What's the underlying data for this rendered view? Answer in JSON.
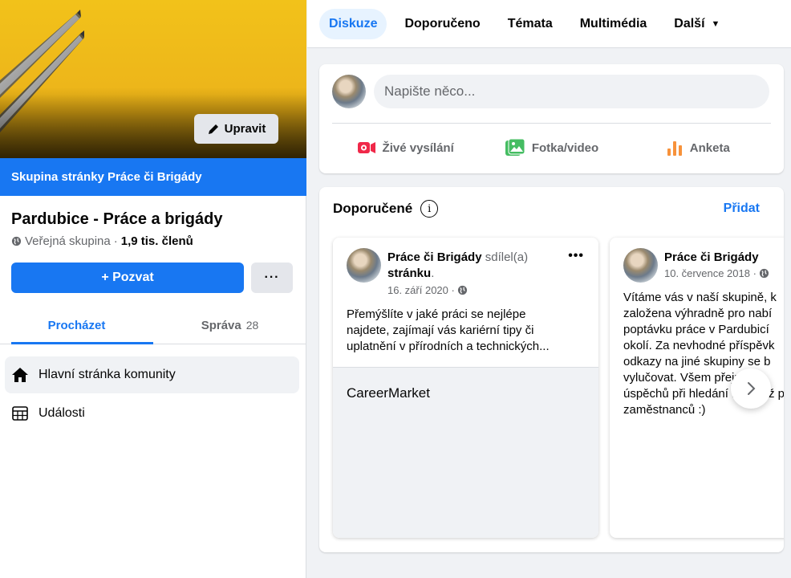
{
  "cover": {
    "edit_label": "Upravit"
  },
  "group": {
    "banner": "Skupina stránky Práce či Brigády",
    "name": "Pardubice - Práce a brigády",
    "privacy": "Veřejná skupina",
    "separator": "·",
    "members": "1,9 tis. členů",
    "invite_label": "+ Pozvat",
    "more_label": "···"
  },
  "left_tabs": [
    {
      "label": "Procházet"
    },
    {
      "label": "Správa",
      "count": "28"
    }
  ],
  "left_nav": [
    {
      "label": "Hlavní stránka komunity",
      "icon": "home-icon"
    },
    {
      "label": "Události",
      "icon": "calendar-icon"
    }
  ],
  "top_nav": [
    {
      "label": "Diskuze"
    },
    {
      "label": "Doporučeno"
    },
    {
      "label": "Témata"
    },
    {
      "label": "Multimédia"
    },
    {
      "label": "Další"
    }
  ],
  "composer": {
    "placeholder": "Napište něco...",
    "actions": [
      {
        "label": "Živé vysílání",
        "icon": "live-video-icon",
        "color": "#f02849"
      },
      {
        "label": "Fotka/video",
        "icon": "photo-icon",
        "color": "#45bd62"
      },
      {
        "label": "Anketa",
        "icon": "poll-icon",
        "color": "#f7923b"
      }
    ]
  },
  "recommended": {
    "title": "Doporučené",
    "add_label": "Přidat",
    "posts": [
      {
        "author": "Práce či Brigády",
        "verb": "sdílel(a)",
        "object": "stránku",
        "date": "16. září 2020 ·",
        "text_lines": [
          "Přemýšlíte v jaké práci se nejlépe",
          "najdete, zajímají vás kariérní tipy či",
          "uplatnění v přírodních a technických..."
        ],
        "link_title": "CareerMarket"
      },
      {
        "author": "Práce či Brigády",
        "date": "10. července 2018 ·",
        "text_lines": [
          "Vítáme vás v naší skupině, k",
          "založena výhradně pro nabí",
          "poptávku práce v Pardubicí",
          "okolí. Za nevhodné příspěvk",
          "odkazy na jiné skupiny se b",
          "vylučovat. Všem přeju ho",
          "úspěchů při hledání nebo už p",
          "zaměstnanců :)"
        ]
      }
    ]
  },
  "colors": {
    "accent": "#1877f2",
    "cover": "#f2c21a"
  }
}
